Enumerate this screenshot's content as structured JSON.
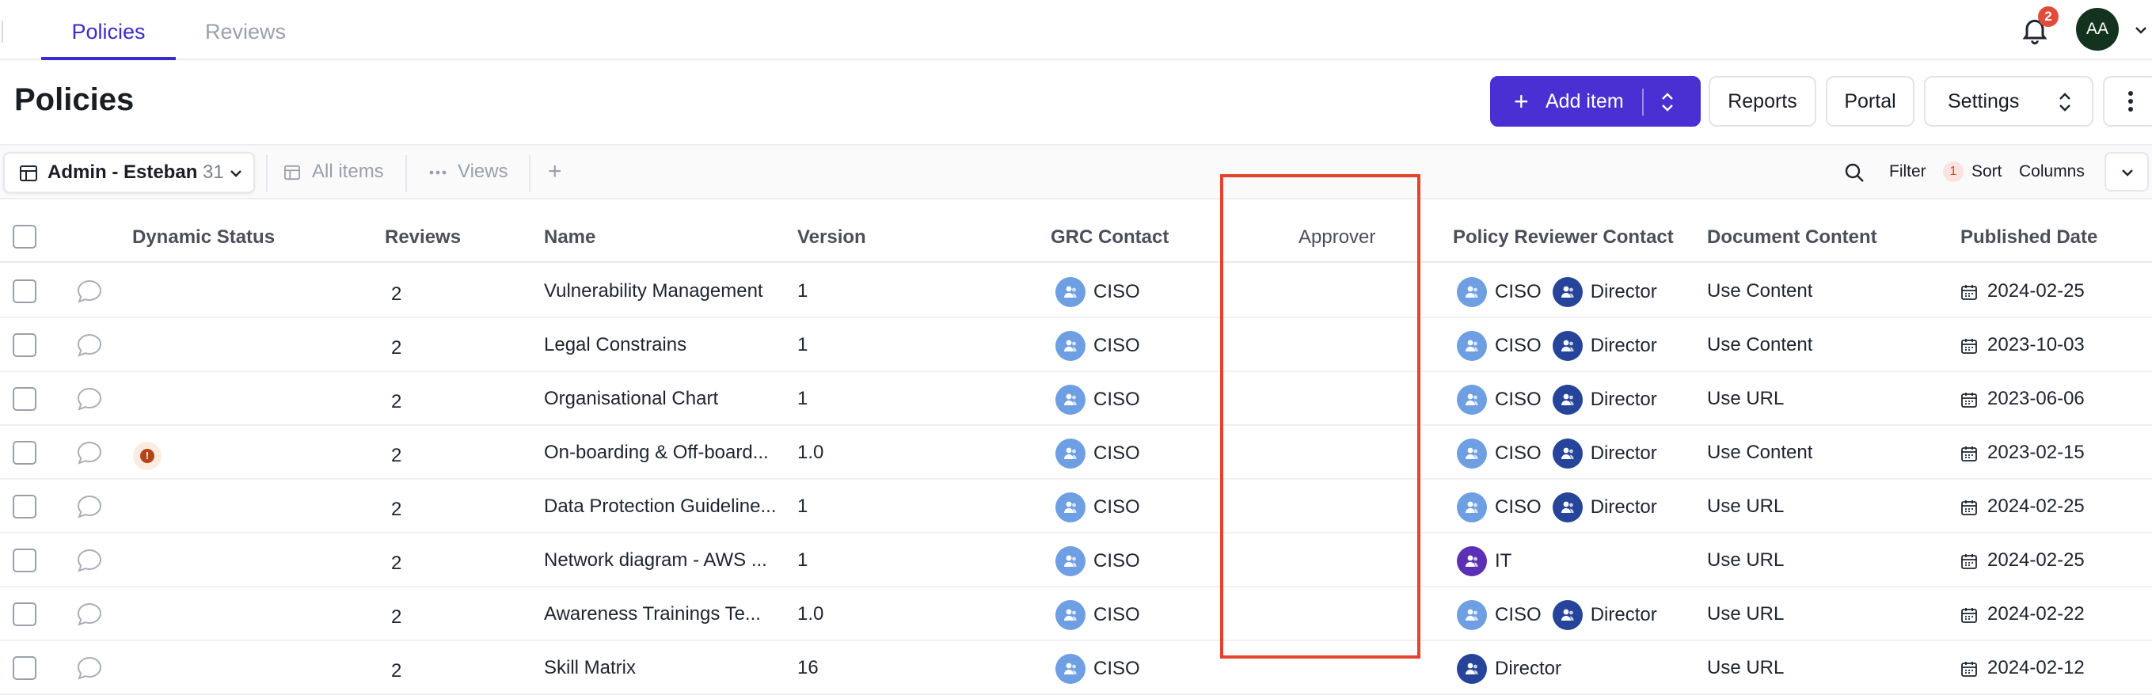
{
  "nav": {
    "tabs": [
      {
        "label": "Policies",
        "active": true
      },
      {
        "label": "Reviews",
        "active": false
      }
    ],
    "notifications_count": "2",
    "user_initials": "AA"
  },
  "header": {
    "title": "Policies",
    "add_item_label": "Add item",
    "reports_label": "Reports",
    "portal_label": "Portal",
    "settings_label": "Settings"
  },
  "toolbar": {
    "view_name": "Admin - Esteban",
    "view_count": "31",
    "all_items_label": "All items",
    "views_label": "Views",
    "add_label": "+",
    "filter_label": "Filter",
    "sort_count": "1",
    "sort_label": "Sort",
    "columns_label": "Columns"
  },
  "table": {
    "columns": [
      "Dynamic Status",
      "Reviews",
      "Name",
      "Version",
      "GRC Contact",
      "Approver",
      "Policy Reviewer Contact",
      "Document Content",
      "Published Date"
    ],
    "rows": [
      {
        "status": false,
        "reviews": "2",
        "name": "Vulnerability Management",
        "version": "1",
        "grc": "CISO",
        "reviewers": [
          "CISO",
          "Director"
        ],
        "content": "Use Content",
        "date": "2024-02-25"
      },
      {
        "status": false,
        "reviews": "2",
        "name": "Legal Constrains",
        "version": "1",
        "grc": "CISO",
        "reviewers": [
          "CISO",
          "Director"
        ],
        "content": "Use Content",
        "date": "2023-10-03"
      },
      {
        "status": false,
        "reviews": "2",
        "name": "Organisational Chart",
        "version": "1",
        "grc": "CISO",
        "reviewers": [
          "CISO",
          "Director"
        ],
        "content": "Use URL",
        "date": "2023-06-06"
      },
      {
        "status": true,
        "reviews": "2",
        "name": "On-boarding & Off-board...",
        "version": "1.0",
        "grc": "CISO",
        "reviewers": [
          "CISO",
          "Director"
        ],
        "content": "Use Content",
        "date": "2023-02-15"
      },
      {
        "status": false,
        "reviews": "2",
        "name": "Data Protection Guideline...",
        "version": "1",
        "grc": "CISO",
        "reviewers": [
          "CISO",
          "Director"
        ],
        "content": "Use URL",
        "date": "2024-02-25"
      },
      {
        "status": false,
        "reviews": "2",
        "name": "Network diagram - AWS ...",
        "version": "1",
        "grc": "CISO",
        "reviewers": [
          "IT"
        ],
        "content": "Use URL",
        "date": "2024-02-25"
      },
      {
        "status": false,
        "reviews": "2",
        "name": "Awareness Trainings Te...",
        "version": "1.0",
        "grc": "CISO",
        "reviewers": [
          "CISO",
          "Director"
        ],
        "content": "Use URL",
        "date": "2024-02-22"
      },
      {
        "status": false,
        "reviews": "2",
        "name": "Skill Matrix",
        "version": "16",
        "grc": "CISO",
        "reviewers": [
          "Director"
        ],
        "content": "Use URL",
        "date": "2024-02-12"
      }
    ]
  },
  "colors": {
    "accent": "#4a2fd3",
    "highlight": "#e5432d",
    "ciso_avatar": "#6e9fe3",
    "director_avatar": "#25449a",
    "it_avatar": "#5b30b5"
  },
  "icons": [
    "bell-icon",
    "chevron-down-icon",
    "plus-icon",
    "updown-icon",
    "more-vertical-icon",
    "table-icon",
    "more-horizontal-icon",
    "search-icon",
    "comment-icon",
    "info-icon",
    "user-group-icon",
    "calendar-icon"
  ]
}
